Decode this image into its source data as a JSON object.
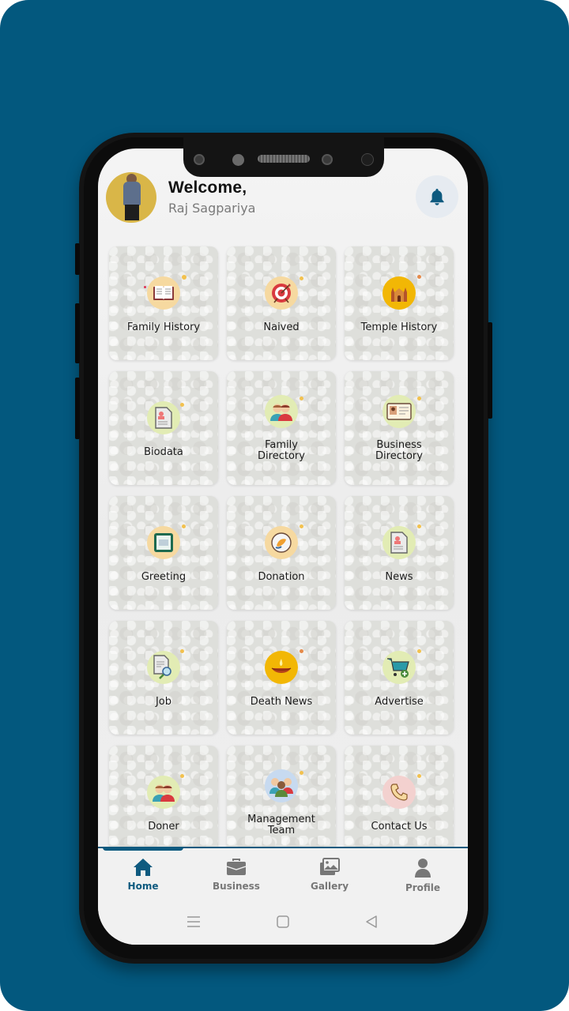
{
  "header": {
    "welcome": "Welcome,",
    "username": "Raj Sagpariya",
    "avatar_icon": "user-photo",
    "notification_icon": "bell-icon"
  },
  "colors": {
    "background": "#03587e",
    "accent": "#0e5a7f",
    "inactive": "#777777"
  },
  "tiles": [
    {
      "label": "Family History",
      "icon": "book-icon"
    },
    {
      "label": "Naived",
      "icon": "target-icon"
    },
    {
      "label": "Temple History",
      "icon": "temple-icon"
    },
    {
      "label": "Biodata",
      "icon": "document-profile-icon"
    },
    {
      "label": "Family Directory",
      "icon": "people-icon"
    },
    {
      "label": "Business Directory",
      "icon": "id-card-icon"
    },
    {
      "label": "Greeting",
      "icon": "greeting-card-icon"
    },
    {
      "label": "Donation",
      "icon": "donation-icon"
    },
    {
      "label": "News",
      "icon": "news-icon"
    },
    {
      "label": "Job",
      "icon": "job-search-icon"
    },
    {
      "label": "Death News",
      "icon": "diya-lamp-icon"
    },
    {
      "label": "Advertise",
      "icon": "cart-icon"
    },
    {
      "label": "Doner",
      "icon": "people-icon"
    },
    {
      "label": "Management Team",
      "icon": "team-icon"
    },
    {
      "label": "Contact Us",
      "icon": "phone-icon"
    }
  ],
  "bottom_nav": [
    {
      "label": "Home",
      "icon": "home-icon",
      "active": true
    },
    {
      "label": "Business",
      "icon": "briefcase-icon",
      "active": false
    },
    {
      "label": "Gallery",
      "icon": "gallery-icon",
      "active": false
    },
    {
      "label": "Profile",
      "icon": "profile-icon",
      "active": false
    }
  ],
  "system_nav": [
    "menu",
    "home",
    "back"
  ]
}
